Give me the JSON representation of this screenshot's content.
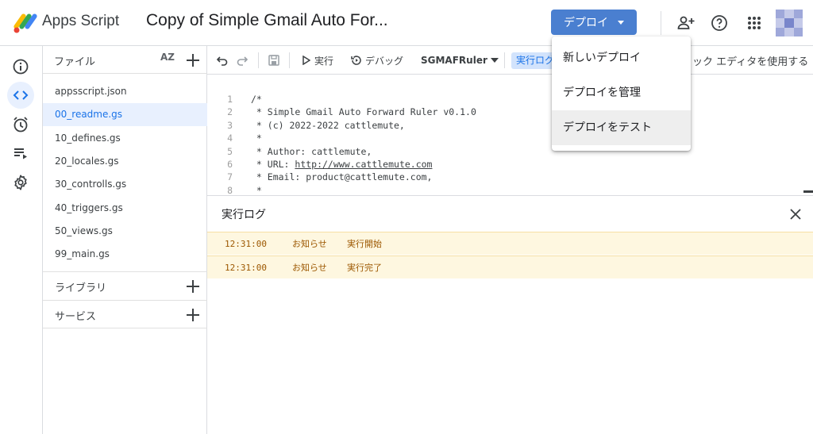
{
  "header": {
    "app_name": "Apps Script",
    "project_title": "Copy of Simple Gmail Auto For...",
    "deploy_label": "デプロイ",
    "icons": [
      "add-person-icon",
      "help-icon",
      "apps-grid-icon",
      "avatar"
    ]
  },
  "rail": {
    "items": [
      {
        "icon": "info-icon",
        "active": false
      },
      {
        "icon": "code-icon",
        "active": true
      },
      {
        "icon": "alarm-clock-icon",
        "active": false
      },
      {
        "icon": "executions-icon",
        "active": false
      },
      {
        "icon": "gear-icon",
        "active": false
      }
    ]
  },
  "files": {
    "title": "ファイル",
    "sort_label": "AZ",
    "items": [
      {
        "name": "appsscript.json",
        "active": false
      },
      {
        "name": "00_readme.gs",
        "active": true
      },
      {
        "name": "10_defines.gs",
        "active": false
      },
      {
        "name": "20_locales.gs",
        "active": false
      },
      {
        "name": "30_controlls.gs",
        "active": false
      },
      {
        "name": "40_triggers.gs",
        "active": false
      },
      {
        "name": "50_views.gs",
        "active": false
      },
      {
        "name": "99_main.gs",
        "active": false
      }
    ],
    "libraries_label": "ライブラリ",
    "services_label": "サービス"
  },
  "toolbar": {
    "run_label": "実行",
    "debug_label": "デバッグ",
    "function_name": "SGMAFRuler",
    "log_label": "実行ログ",
    "legacy_editor_label": "ック エディタを使用する"
  },
  "editor": {
    "lines": [
      {
        "n": "1",
        "text": "/*"
      },
      {
        "n": "2",
        "text": " * Simple Gmail Auto Forward Ruler v0.1.0"
      },
      {
        "n": "3",
        "text": " * (c) 2022-2022 cattlemute,"
      },
      {
        "n": "4",
        "text": " *"
      },
      {
        "n": "5",
        "text": " * Author: cattlemute,"
      },
      {
        "n": "6",
        "text": " * URL: ",
        "link": "http://www.cattlemute.com"
      },
      {
        "n": "7",
        "text": " * Email: product@cattlemute.com,"
      },
      {
        "n": "8",
        "text": " *"
      }
    ]
  },
  "log": {
    "title": "実行ログ",
    "rows": [
      {
        "time": "12:31:00",
        "level": "お知らせ",
        "message": "実行開始"
      },
      {
        "time": "12:31:00",
        "level": "お知らせ",
        "message": "実行完了"
      }
    ]
  },
  "deploy_menu": {
    "items": [
      "新しいデプロイ",
      "デプロイを管理",
      "デプロイをテスト"
    ],
    "hovered_index": 2
  },
  "colors": {
    "accent": "#4a7fd0",
    "active_bg": "#e8f0fe",
    "log_bg": "#fef7e0",
    "log_text": "#9c5700"
  }
}
